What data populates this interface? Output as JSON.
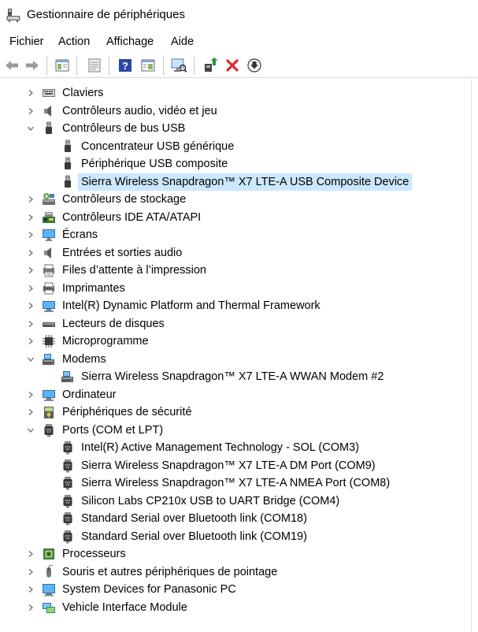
{
  "window": {
    "title": "Gestionnaire de périphériques"
  },
  "menu": [
    "Fichier",
    "Action",
    "Affichage",
    "Aide"
  ],
  "toolbar": [
    "back-icon",
    "forward-icon",
    "properties-pane-icon",
    "list-view-icon",
    "help-icon",
    "panel-icon",
    "scan-hardware-icon",
    "update-driver-icon",
    "uninstall-device-icon",
    "download-driver-icon"
  ],
  "tree": [
    {
      "label": "Claviers",
      "level": 0,
      "expander": "collapsed",
      "icon": "keyboard-icon"
    },
    {
      "label": "Contrôleurs audio, vidéo et jeu",
      "level": 0,
      "expander": "collapsed",
      "icon": "speaker-icon"
    },
    {
      "label": "Contrôleurs de bus USB",
      "level": 0,
      "expander": "expanded",
      "icon": "usb-plug-icon"
    },
    {
      "label": "Concentrateur USB générique",
      "level": 1,
      "expander": "none",
      "icon": "usb-plug-icon"
    },
    {
      "label": "Périphérique USB composite",
      "level": 1,
      "expander": "none",
      "icon": "usb-plug-icon"
    },
    {
      "label": "Sierra Wireless Snapdragon™ X7 LTE-A USB Composite Device",
      "level": 1,
      "expander": "none",
      "icon": "usb-plug-icon",
      "selected": true
    },
    {
      "label": "Contrôleurs de stockage",
      "level": 0,
      "expander": "collapsed",
      "icon": "storage-controller-icon"
    },
    {
      "label": "Contrôleurs IDE ATA/ATAPI",
      "level": 0,
      "expander": "collapsed",
      "icon": "ide-controller-icon"
    },
    {
      "label": "Écrans",
      "level": 0,
      "expander": "collapsed",
      "icon": "monitor-icon"
    },
    {
      "label": "Entrées et sorties audio",
      "level": 0,
      "expander": "collapsed",
      "icon": "speaker-icon"
    },
    {
      "label": "Files d’attente à l’impression",
      "level": 0,
      "expander": "collapsed",
      "icon": "print-queue-icon"
    },
    {
      "label": "Imprimantes",
      "level": 0,
      "expander": "collapsed",
      "icon": "printer-icon"
    },
    {
      "label": "Intel(R) Dynamic Platform and Thermal Framework",
      "level": 0,
      "expander": "collapsed",
      "icon": "computer-icon"
    },
    {
      "label": "Lecteurs de disques",
      "level": 0,
      "expander": "collapsed",
      "icon": "disk-drive-icon"
    },
    {
      "label": "Microprogramme",
      "level": 0,
      "expander": "collapsed",
      "icon": "chip-icon"
    },
    {
      "label": "Modems",
      "level": 0,
      "expander": "expanded",
      "icon": "modem-icon"
    },
    {
      "label": "Sierra Wireless Snapdragon™ X7 LTE-A WWAN Modem #2",
      "level": 1,
      "expander": "none",
      "icon": "modem-icon"
    },
    {
      "label": "Ordinateur",
      "level": 0,
      "expander": "collapsed",
      "icon": "computer-icon"
    },
    {
      "label": "Périphériques de sécurité",
      "level": 0,
      "expander": "collapsed",
      "icon": "security-key-icon"
    },
    {
      "label": "Ports (COM et LPT)",
      "level": 0,
      "expander": "expanded",
      "icon": "port-icon"
    },
    {
      "label": "Intel(R) Active Management Technology - SOL (COM3)",
      "level": 1,
      "expander": "none",
      "icon": "port-icon"
    },
    {
      "label": "Sierra Wireless Snapdragon™ X7 LTE-A DM Port (COM9)",
      "level": 1,
      "expander": "none",
      "icon": "port-icon"
    },
    {
      "label": "Sierra Wireless Snapdragon™ X7 LTE-A NMEA Port (COM8)",
      "level": 1,
      "expander": "none",
      "icon": "port-icon"
    },
    {
      "label": "Silicon Labs CP210x USB to UART Bridge (COM4)",
      "level": 1,
      "expander": "none",
      "icon": "port-icon"
    },
    {
      "label": "Standard Serial over Bluetooth link (COM18)",
      "level": 1,
      "expander": "none",
      "icon": "port-icon"
    },
    {
      "label": "Standard Serial over Bluetooth link (COM19)",
      "level": 1,
      "expander": "none",
      "icon": "port-icon"
    },
    {
      "label": "Processeurs",
      "level": 0,
      "expander": "collapsed",
      "icon": "processor-icon"
    },
    {
      "label": "Souris et autres périphériques de pointage",
      "level": 0,
      "expander": "collapsed",
      "icon": "mouse-icon"
    },
    {
      "label": "System Devices for Panasonic PC",
      "level": 0,
      "expander": "collapsed",
      "icon": "system-device-icon"
    },
    {
      "label": "Vehicle Interface Module",
      "level": 0,
      "expander": "collapsed",
      "icon": "network-icon"
    }
  ],
  "colors": {
    "selection": "#cce8ff",
    "arrow": "#6b6b6b",
    "accent": "#2b78c5",
    "uninstall_red": "#e0262b",
    "update_green": "#1d9a3a"
  }
}
